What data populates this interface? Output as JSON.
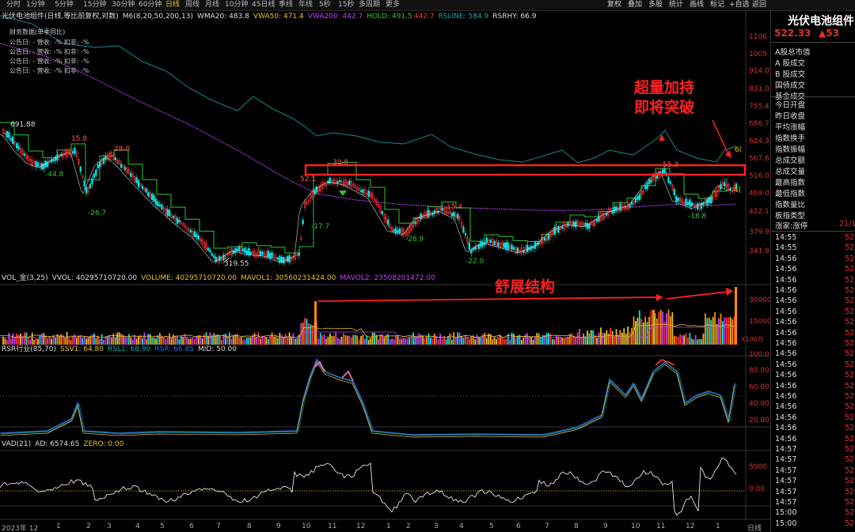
{
  "toolbar": {
    "tabs": [
      "分时",
      "1分钟",
      "5分钟",
      "15分钟",
      "30分钟",
      "60分钟",
      "日线",
      "周线",
      "月线",
      "10分钟",
      "45日线",
      "季线",
      "年线",
      "5秒",
      "15秒",
      "多周期",
      "更多"
    ],
    "active": "日线",
    "tools": [
      "复权",
      "叠加",
      "多股",
      "统计",
      "画线",
      "标记",
      "+自选",
      "返回"
    ]
  },
  "main_ind": {
    "name": "光伏电池组件(日线,等比前复权,对数)",
    "m6": "M6(8,20,50,200,13)",
    "wma20": "WMA20: 483.8",
    "vwa50": "VWA50: 471.4",
    "vwa200": "VWA200: 442.7",
    "hold": "HOLD: 491.5",
    "hold2": "442.7",
    "rsline": "RSLINE: 584.9",
    "rsrhy": "RSRHY: 66.9"
  },
  "fin": {
    "title": "财务数据(单季同比)",
    "rows": [
      "公告日: -   营收: -%   扣非: -%",
      "公告日: -   营收: -%   扣非: -%",
      "公告日: -   营收: -%   扣非: -%",
      "公告日: -   营收: -%   扣非: -%"
    ]
  },
  "price_axis": [
    "1106",
    "1005",
    "914.0",
    "831.0",
    "755.4",
    "686.7",
    "624.3",
    "567.6",
    "516.0",
    "469.0",
    "422.1",
    "379.9",
    "341.9"
  ],
  "price_labels": {
    "hi1": "691.88",
    "l1": "15.8",
    "l2": "28.0",
    "l3": "-44.8",
    "l4": "-26.7",
    "l5": "52.1",
    "l6": "30.8",
    "l7": "-17.7",
    "l8": "15.4",
    "l9": "-28.9",
    "l10": "-22.0",
    "l11": "55.3",
    "l12": "-18.8",
    "lo": "319.55",
    "edge1": "6(",
    "edge2": "4("
  },
  "anno": {
    "a1": "超量加持",
    "a2": "即将突破",
    "a3": "舒展结构"
  },
  "vol": {
    "t1": "VOL_金(3,25)",
    "t2": "VVOL: 40295710720.00",
    "t3": "VOLUME: 40295710720.00",
    "t4": "MAVOL1: 30560231424.00",
    "t5": "MAVOL2: 23508201472.00",
    "axis": [
      "30000",
      "15000"
    ],
    "unit": "X100万"
  },
  "rsr": {
    "t1": "RSR行业(85,70)",
    "t2": "SSV1: 64.80",
    "t3": "RSL1: 68.90",
    "t4": "RSR: 66.85",
    "t5": "MID: 50.00",
    "axis": [
      "100.0",
      "80.00",
      "60.00",
      "40.00",
      "20.00"
    ]
  },
  "vad": {
    "t1": "VAD(21)",
    "t2": "AD: 6574.65",
    "t3": "ZERO: 0.00",
    "axis": [
      "5000",
      "0.00"
    ]
  },
  "dates": [
    "2023年 12",
    "1",
    "2",
    "3",
    "4",
    "5",
    "6",
    "7",
    "8",
    "9",
    "10",
    "11",
    "12",
    "1",
    "2",
    "3",
    "4",
    "5",
    "6",
    "7",
    "8",
    "9",
    "10",
    "11",
    "12",
    "1"
  ],
  "date_end": "日线",
  "right_panel": {
    "title": "光伏电池组件",
    "price": "522.33",
    "price2": "▲53",
    "items": [
      "A股总市值",
      "A 股成交",
      "B 股成交",
      "国债成交",
      "基金成交",
      "今日开盘",
      "昨日收盘",
      "平均涨幅",
      "指数换手",
      "指数振幅",
      "总成交额",
      "总成交量",
      "最高指数",
      "最低指数",
      "指数量比",
      "板指类型",
      "涨家:涨停"
    ],
    "zd": "21/1",
    "times": [
      "14:55",
      "14:55",
      "14:56",
      "14:56",
      "14:56",
      "14:56",
      "14:56",
      "14:56",
      "14:56",
      "14:56",
      "14:56",
      "14:56",
      "14:56",
      "14:56",
      "14:56",
      "14:56",
      "14:56",
      "14:56",
      "14:56",
      "14:56",
      "14:57",
      "14:57",
      "14:57",
      "14:57",
      "14:57",
      "14:57",
      "15:00",
      "15:00"
    ],
    "val": "52"
  },
  "colors": {
    "up": "#ff3333",
    "down": "#00e5e5",
    "accent": "#e6c12a",
    "rsline": "#138a8a",
    "purple": "#c040ff",
    "hold": "#2ec42e"
  }
}
